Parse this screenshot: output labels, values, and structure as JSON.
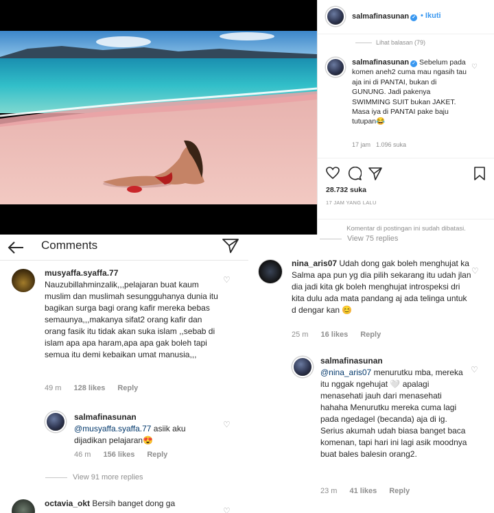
{
  "post": {
    "username": "salmafinasunan",
    "follow_label": "Ikuti",
    "view_replies": "Lihat balasan (79)",
    "caption": {
      "username": "salmafinasunan",
      "text": " Sebelum pada komen aneh2 cuma mau ngasih tau aja ini di PANTAI, bukan di GUNUNG. Jadi pakenya SWIMMING SUIT bukan JAKET. Masa iya di PANTAI pake baju tutupan😂",
      "time": "17 jam",
      "likes": "1.096 suka"
    },
    "likes_count": "28.732 suka",
    "time_ago": "17 JAM YANG LALU",
    "comments_closed": "Komentar di postingan ini sudah dibatasi."
  },
  "app": {
    "title": "Comments"
  },
  "left": {
    "c1": {
      "username": "musyaffa.syaffa.77",
      "text": "Nauzubillahminzalik,,,pelajaran buat kaum muslim dan muslimah sesungguhanya dunia itu bagikan surga bagi orang kafir mereka bebas semaunya,,,makanya sifat2 orang kafir dan orang fasik itu tidak akan suka islam ,,sebab di islam apa apa haram,apa apa gak boleh tapi semua itu demi kebaikan umat manusia,,,",
      "time": "49 m",
      "likes": "128 likes",
      "reply": "Reply"
    },
    "c2": {
      "username": "salmafinasunan",
      "mention": "@musyaffa.syaffa.77",
      "text": " asiik aku dijadikan pelajaran😍",
      "time": "46 m",
      "likes": "156 likes",
      "reply": "Reply"
    },
    "more_replies": "View 91 more replies",
    "c3": {
      "username": "octavia_okt",
      "text": "Bersih banget dong ga"
    }
  },
  "right": {
    "more_replies": "View 75 replies",
    "c4": {
      "username": "nina_aris07",
      "text": "Udah dong gak boleh menghujat ka Salma apa pun yg dia pilih sekarang itu udah jlan dia jadi kita gk boleh menghujat introspeksi dri kita dulu ada mata pandang aj ada telinga untuk d dengar kan 😊",
      "time": "25 m",
      "likes": "16 likes",
      "reply": "Reply"
    },
    "c5": {
      "username": "salmafinasunan",
      "mention": "@nina_aris07",
      "text": " menurutku mba, mereka itu nggak ngehujat 🤍 apalagi menasehati jauh dari menasehati hahaha Menurutku mereka cuma lagi pada ngedagel (becanda) aja di ig. Serius akumah udah biasa banget baca komenan, tapi hari ini lagi asik moodnya buat bales balesin orang2.",
      "time": "23 m",
      "likes": "41 likes",
      "reply": "Reply"
    }
  },
  "colors": {
    "link": "#3897f0",
    "meta": "#8e8e8e",
    "text": "#262626",
    "mention": "#00376b"
  }
}
